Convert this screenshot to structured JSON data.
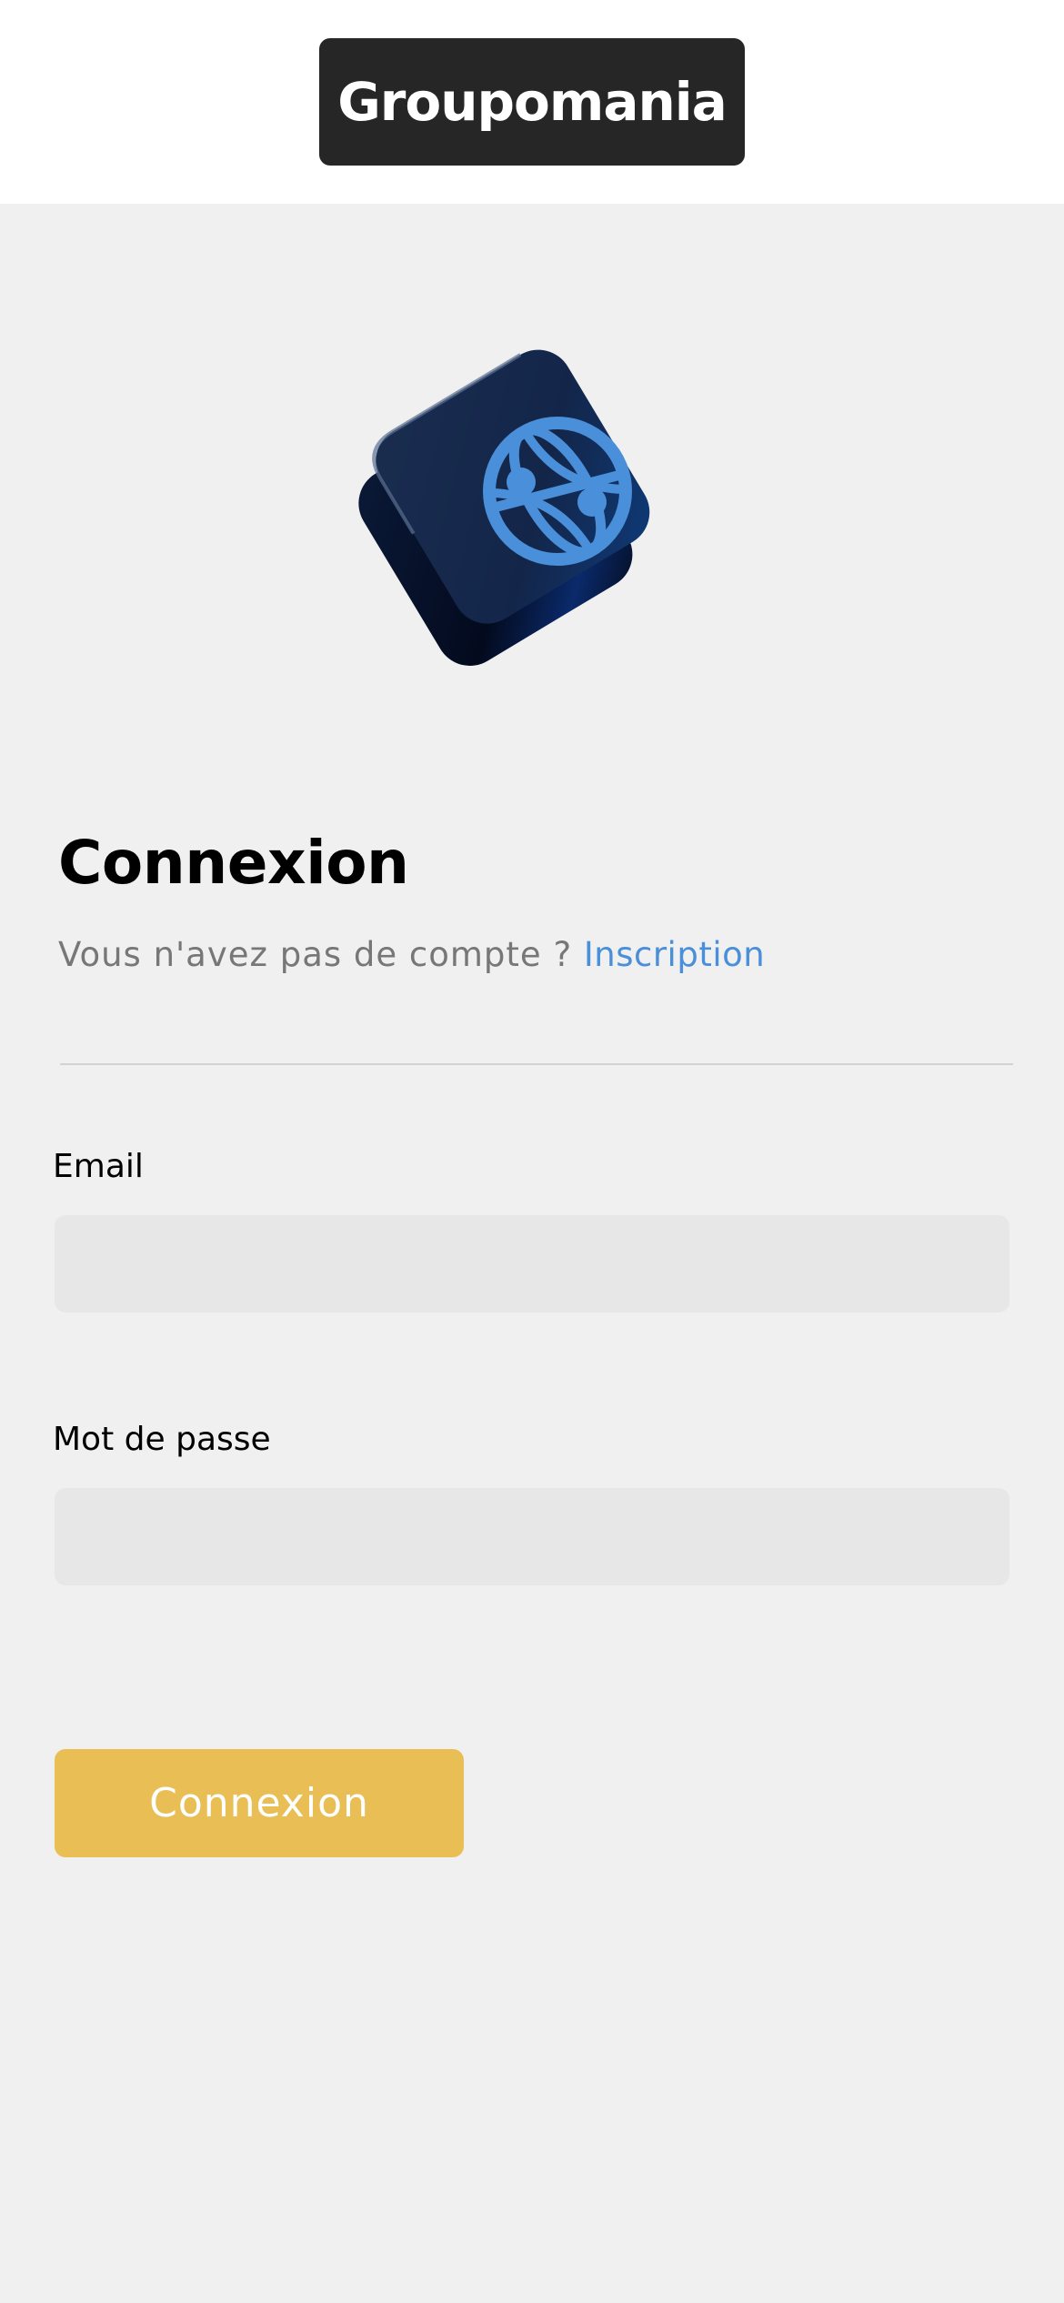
{
  "header": {
    "brand": "Groupomania"
  },
  "logo": {
    "icon": "globe-network-icon",
    "colors": {
      "tile_dark": "#0a1730",
      "tile_face": "#152a4a",
      "globe": "#4a8fd9"
    }
  },
  "login": {
    "title": "Connexion",
    "prompt": "Vous n'avez pas de compte ? ",
    "signup_link": "Inscription",
    "email_label": "Email",
    "email_value": "",
    "password_label": "Mot de passe",
    "password_value": "",
    "submit_label": "Connexion"
  },
  "colors": {
    "background": "#f0f0f0",
    "brand_bg": "#262626",
    "link": "#4a8fd9",
    "button": "#e8be55",
    "input_bg": "#e7e7e7"
  }
}
